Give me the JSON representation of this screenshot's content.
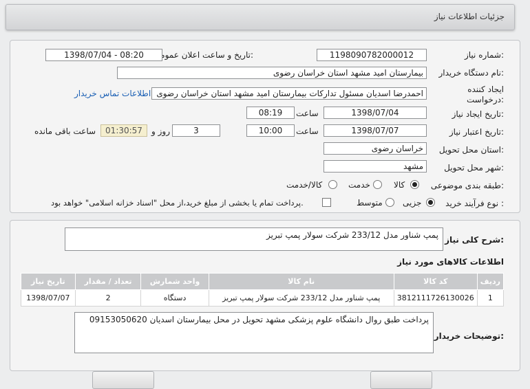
{
  "window": {
    "title": "جزئیات اطلاعات نیاز"
  },
  "form": {
    "need_number_label": "شماره نیاز:",
    "need_number": "1198090782000012",
    "announce_label": "تاریخ و ساعت اعلان عمومی:",
    "announce_value": "1398/07/04 - 08:20",
    "buyer_label": "نام دستگاه خریدار:",
    "buyer_value": "بیمارستان امید مشهد استان خراسان رضوی",
    "creator_label_line1": "ایجاد کننده",
    "creator_label_line2": "درخواست:",
    "creator_value": "احمدرضا اسدیان مسئول تدارکات بیمارستان امید مشهد استان خراسان رضوی",
    "contact_link": "اطلاعات تماس خریدار",
    "created_date_label": "تاریخ ایجاد نیاز:",
    "created_date": "1398/07/04",
    "time_label": "ساعت",
    "created_time": "08:19",
    "valid_date_label": "تاریخ اعتبار نیاز:",
    "valid_date": "1398/07/07",
    "valid_time": "10:00",
    "days_value": "3",
    "days_label": "روز و",
    "remaining_time": "01:30:57",
    "remaining_label": "ساعت باقی مانده",
    "province_label": "استان محل تحویل:",
    "province_value": "خراسان رضوی",
    "city_label": "شهر محل تحویل:",
    "city_value": "مشهد",
    "category_label": "طبقه بندی موضوعی:",
    "category_options": [
      "کالا",
      "خدمت",
      "کالا/خدمت"
    ],
    "category_selected": "کالا",
    "process_label": "نوع فرآیند خرید :",
    "process_options": [
      "جزیی",
      "متوسط"
    ],
    "process_selected": "جزیی",
    "payment_note": "پرداخت تمام یا بخشی از مبلغ خرید،از محل \"اسناد خزانه اسلامی\" خواهد بود."
  },
  "description": {
    "label": "شرح کلی نیاز:",
    "value": "پمپ شناور مدل 233/12 شرکت سولار پمپ تبریز"
  },
  "goods": {
    "section_title": "اطلاعات کالاهای مورد نیاز",
    "headers": [
      "ردیف",
      "کد کالا",
      "نام کالا",
      "واحد شمارش",
      "تعداد / مقدار",
      "تاریخ نیاز"
    ],
    "rows": [
      [
        "1",
        "3812111726130026",
        "پمپ شناور مدل 233/12 شرکت سولار پمپ تبریز",
        "دستگاه",
        "2",
        "1398/07/07"
      ]
    ]
  },
  "buyer_notes": {
    "label": "توضیحات خریدار:",
    "value": "پرداخت طبق روال دانشگاه علوم پزشکی مشهد تحویل در محل بیمارستان اسدیان 09153050620"
  }
}
